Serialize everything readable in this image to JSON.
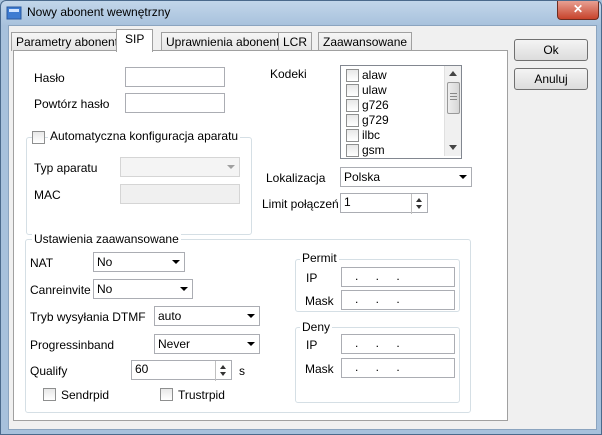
{
  "window": {
    "title": "Nowy abonent wewnętrzny",
    "controls": {
      "close_glyph": "✕"
    }
  },
  "buttons": {
    "ok": "Ok",
    "cancel": "Anuluj"
  },
  "tabs": [
    {
      "label": "Parametry abonenta",
      "active": false
    },
    {
      "label": "SIP",
      "active": true
    },
    {
      "label": "Uprawnienia abonenta",
      "active": false
    },
    {
      "label": "LCR",
      "active": false
    },
    {
      "label": "Zaawansowane",
      "active": false
    }
  ],
  "sip": {
    "password_label": "Hasło",
    "password_value": "",
    "repeat_password_label": "Powtórz hasło",
    "repeat_password_value": "",
    "codecs_label": "Kodeki",
    "codecs": [
      "alaw",
      "ulaw",
      "g726",
      "g729",
      "ilbc",
      "gsm"
    ],
    "autoconfig_label": "Automatyczna konfiguracja aparatu",
    "device_type_label": "Typ aparatu",
    "device_type_value": "",
    "mac_label": "MAC",
    "mac_value": "",
    "location_label": "Lokalizacja",
    "location_value": "Polska",
    "call_limit_label": "Limit połączeń",
    "call_limit_value": "1"
  },
  "advanced": {
    "title": "Ustawienia zaawansowane",
    "nat_label": "NAT",
    "nat_value": "No",
    "canreinvite_label": "Canreinvite",
    "canreinvite_value": "No",
    "dtmf_label": "Tryb wysyłania DTMF",
    "dtmf_value": "auto",
    "progressinband_label": "Progressinband",
    "progressinband_value": "Never",
    "qualify_label": "Qualify",
    "qualify_value": "60",
    "qualify_unit": "s",
    "sendrpid_label": "Sendrpid",
    "trustrpid_label": "Trustrpid",
    "permit": {
      "title": "Permit",
      "ip_label": "IP",
      "ip_value": ". . .",
      "mask_label": "Mask",
      "mask_value": ". . ."
    },
    "deny": {
      "title": "Deny",
      "ip_label": "IP",
      "ip_value": ". . .",
      "mask_label": "Mask",
      "mask_value": ". . ."
    }
  }
}
